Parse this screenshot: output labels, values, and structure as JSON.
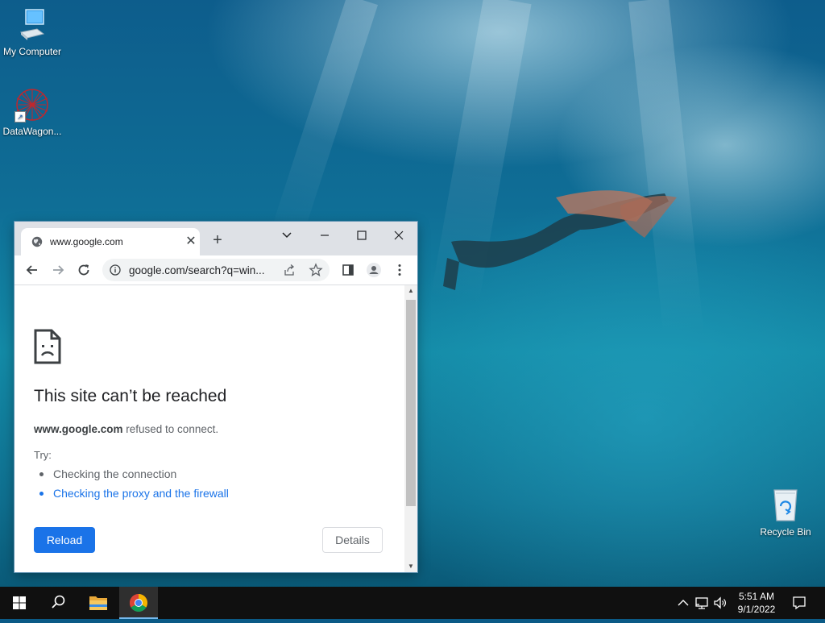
{
  "desktop": {
    "icons": [
      {
        "label": "My Computer"
      },
      {
        "label": "DataWagon..."
      },
      {
        "label": "Recycle Bin"
      }
    ]
  },
  "browser": {
    "tab": {
      "title": "www.google.com"
    },
    "omnibox": {
      "url": "google.com/search?q=win..."
    },
    "page": {
      "title": "This site can’t be reached",
      "host": "www.google.com",
      "message": " refused to connect.",
      "try_label": "Try:",
      "suggestions": [
        {
          "text": "Checking the connection"
        },
        {
          "text": "Checking the proxy and the firewall"
        }
      ],
      "reload_label": "Reload",
      "details_label": "Details"
    }
  },
  "taskbar": {
    "clock_time": "5:51 AM",
    "clock_date": "9/1/2022"
  },
  "colors": {
    "accent": "#1a73e8",
    "taskbar": "#101010"
  }
}
